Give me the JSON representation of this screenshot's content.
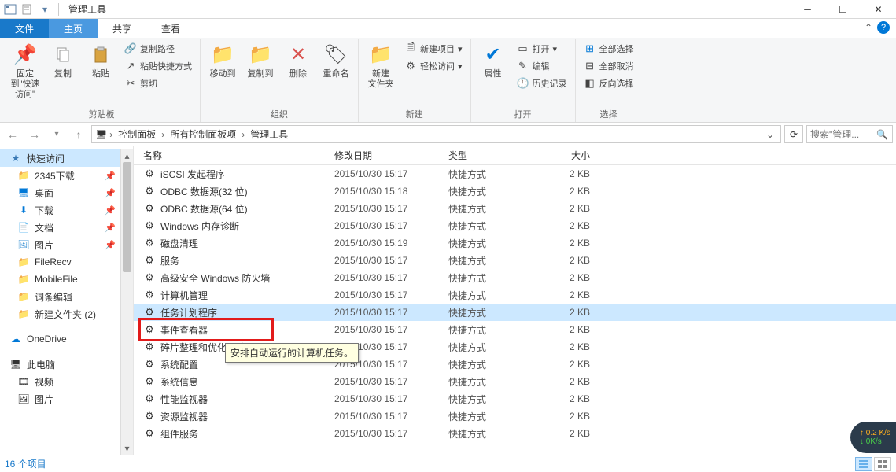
{
  "window": {
    "title": "管理工具"
  },
  "tabs": {
    "file": "文件",
    "home": "主页",
    "share": "共享",
    "view": "查看"
  },
  "ribbon": {
    "clipboard": {
      "label": "剪贴板",
      "pin": "固定到\"快速访问\"",
      "copy": "复制",
      "paste": "粘贴",
      "copyPath": "复制路径",
      "pasteShortcut": "粘贴快捷方式",
      "cut": "剪切"
    },
    "organize": {
      "label": "组织",
      "moveTo": "移动到",
      "copyTo": "复制到",
      "delete": "删除",
      "rename": "重命名"
    },
    "new": {
      "label": "新建",
      "newFolder": "新建\n文件夹",
      "newItem": "新建项目",
      "easyAccess": "轻松访问"
    },
    "open": {
      "label": "打开",
      "properties": "属性",
      "open": "打开",
      "edit": "编辑",
      "history": "历史记录"
    },
    "select": {
      "label": "选择",
      "selectAll": "全部选择",
      "selectNone": "全部取消",
      "invert": "反向选择"
    }
  },
  "breadcrumb": {
    "items": [
      "控制面板",
      "所有控制面板项",
      "管理工具"
    ]
  },
  "search": {
    "placeholder": "搜索\"管理..."
  },
  "nav": {
    "quick": "快速访问",
    "items": [
      {
        "label": "2345下载",
        "icon": "folder",
        "color": "#f0c23b",
        "pin": true
      },
      {
        "label": "桌面",
        "icon": "desktop",
        "color": "#0078d7",
        "pin": true
      },
      {
        "label": "下载",
        "icon": "download",
        "color": "#0078d7",
        "pin": true
      },
      {
        "label": "文档",
        "icon": "doc",
        "color": "#6aa6cc",
        "pin": true
      },
      {
        "label": "图片",
        "icon": "pic",
        "color": "#4b9bd8",
        "pin": true
      },
      {
        "label": "FileRecv",
        "icon": "folder",
        "color": "#f0c23b",
        "pin": false
      },
      {
        "label": "MobileFile",
        "icon": "folder",
        "color": "#f0c23b",
        "pin": false
      },
      {
        "label": "词条编辑",
        "icon": "folder",
        "color": "#f0c23b",
        "pin": false
      },
      {
        "label": "新建文件夹 (2)",
        "icon": "folder",
        "color": "#f0c23b",
        "pin": false
      }
    ],
    "onedrive": "OneDrive",
    "thispc": "此电脑",
    "video": "视频",
    "pics": "图片"
  },
  "columns": {
    "name": "名称",
    "date": "修改日期",
    "type": "类型",
    "size": "大小"
  },
  "files": [
    {
      "name": "iSCSI 发起程序",
      "date": "2015/10/30 15:17",
      "type": "快捷方式",
      "size": "2 KB"
    },
    {
      "name": "ODBC 数据源(32 位)",
      "date": "2015/10/30 15:18",
      "type": "快捷方式",
      "size": "2 KB"
    },
    {
      "name": "ODBC 数据源(64 位)",
      "date": "2015/10/30 15:17",
      "type": "快捷方式",
      "size": "2 KB"
    },
    {
      "name": "Windows 内存诊断",
      "date": "2015/10/30 15:17",
      "type": "快捷方式",
      "size": "2 KB"
    },
    {
      "name": "磁盘清理",
      "date": "2015/10/30 15:19",
      "type": "快捷方式",
      "size": "2 KB"
    },
    {
      "name": "服务",
      "date": "2015/10/30 15:17",
      "type": "快捷方式",
      "size": "2 KB"
    },
    {
      "name": "高级安全 Windows 防火墙",
      "date": "2015/10/30 15:17",
      "type": "快捷方式",
      "size": "2 KB"
    },
    {
      "name": "计算机管理",
      "date": "2015/10/30 15:17",
      "type": "快捷方式",
      "size": "2 KB"
    },
    {
      "name": "任务计划程序",
      "date": "2015/10/30 15:17",
      "type": "快捷方式",
      "size": "2 KB",
      "selected": true
    },
    {
      "name": "事件查看器",
      "date": "2015/10/30 15:17",
      "type": "快捷方式",
      "size": "2 KB"
    },
    {
      "name": "碎片整理和优化驱动器",
      "date": "2015/10/30 15:17",
      "type": "快捷方式",
      "size": "2 KB"
    },
    {
      "name": "系统配置",
      "date": "2015/10/30 15:17",
      "type": "快捷方式",
      "size": "2 KB"
    },
    {
      "name": "系统信息",
      "date": "2015/10/30 15:17",
      "type": "快捷方式",
      "size": "2 KB"
    },
    {
      "name": "性能监视器",
      "date": "2015/10/30 15:17",
      "type": "快捷方式",
      "size": "2 KB"
    },
    {
      "name": "资源监视器",
      "date": "2015/10/30 15:17",
      "type": "快捷方式",
      "size": "2 KB"
    },
    {
      "name": "组件服务",
      "date": "2015/10/30 15:17",
      "type": "快捷方式",
      "size": "2 KB"
    }
  ],
  "tooltip": "安排自动运行的计算机任务。",
  "status": {
    "count": "16 个项目"
  },
  "bubble": {
    "up": "↑ 0.2 K/s",
    "dn": "↓ 0K/s"
  }
}
